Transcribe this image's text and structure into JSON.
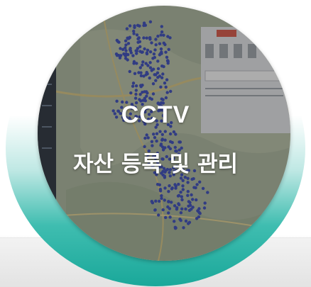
{
  "title": {
    "line1": "CCTV",
    "line2": "자산 등록 및 관리"
  },
  "colors": {
    "accent_teal": "#1aa89a",
    "map_pins": "#2b3fb8",
    "sidebar_dark": "#1b2430",
    "overlay": "#3a3a3a"
  },
  "screenshot": {
    "panel_button_color": "#d94a3a"
  }
}
